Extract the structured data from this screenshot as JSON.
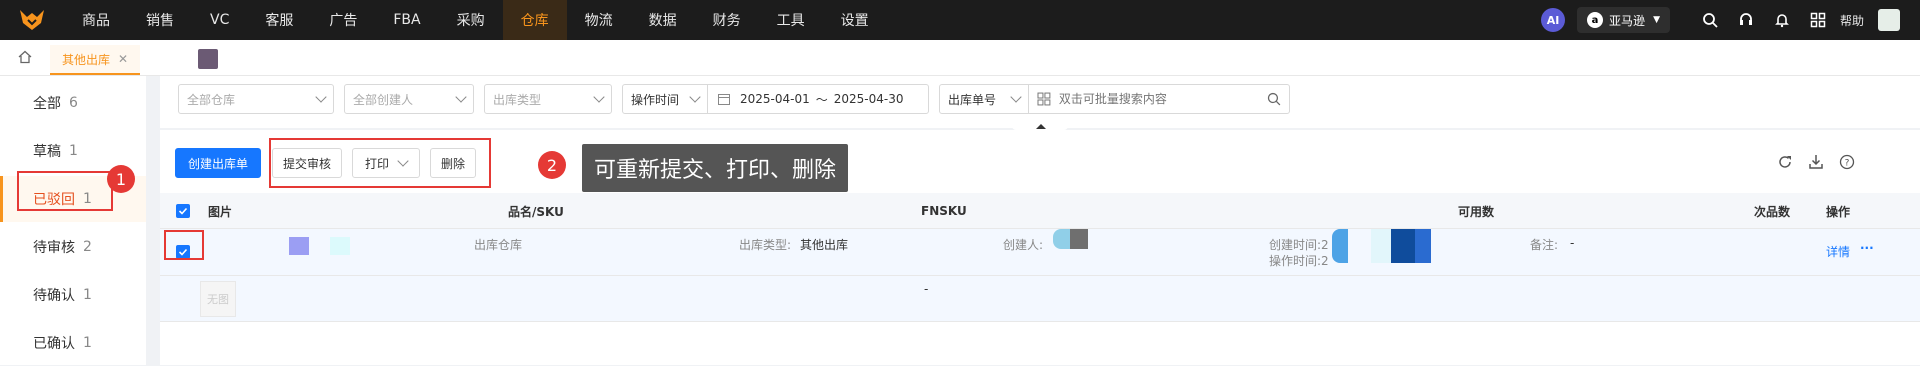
{
  "nav": {
    "items": [
      "商品",
      "销售",
      "VC",
      "客服",
      "广告",
      "FBA",
      "采购",
      "仓库",
      "物流",
      "数据",
      "财务",
      "工具",
      "设置"
    ],
    "active_index": 7,
    "ai_label": "AI",
    "store_label": "亚马逊",
    "help_label": "帮助",
    "accent_color": "#f7941d"
  },
  "tabs": {
    "current": "其他出库"
  },
  "sidebar": {
    "items": [
      {
        "label": "全部",
        "count": "6"
      },
      {
        "label": "草稿",
        "count": "1"
      },
      {
        "label": "已驳回",
        "count": "1"
      },
      {
        "label": "待审核",
        "count": "2"
      },
      {
        "label": "待确认",
        "count": "1"
      },
      {
        "label": "已确认",
        "count": "1"
      }
    ],
    "active_index": 2
  },
  "filters": {
    "warehouse": "全部仓库",
    "creator": "全部创建人",
    "out_type": "出库类型",
    "time_type": "操作时间",
    "date_start": "2025-04-01",
    "date_sep": "～",
    "date_end": "2025-04-30",
    "search_field": "出库单号",
    "search_placeholder": "双击可批量搜索内容"
  },
  "toolbar": {
    "create": "创建出库单",
    "submit": "提交审核",
    "print": "打印",
    "delete": "删除"
  },
  "annotations": {
    "badge1": "1",
    "badge2": "2",
    "tooltip": "可重新提交、打印、删除"
  },
  "table": {
    "headers": {
      "image": "图片",
      "name_sku": "品名/SKU",
      "fnsku": "FNSKU",
      "available": "可用数",
      "defective": "次品数",
      "action": "操作"
    },
    "row": {
      "warehouse_label": "出库仓库",
      "type_label": "出库类型:",
      "type_value": "其他出库",
      "creator_label": "创建人:",
      "created_label": "创建时间:",
      "created_value": "2",
      "operated_label": "操作时间:",
      "operated_value": "2",
      "remark_label": "备注:",
      "remark_value": "-",
      "detail_link": "详情",
      "more": "···"
    },
    "item": {
      "no_image": "无图",
      "fnsku": "-"
    }
  }
}
